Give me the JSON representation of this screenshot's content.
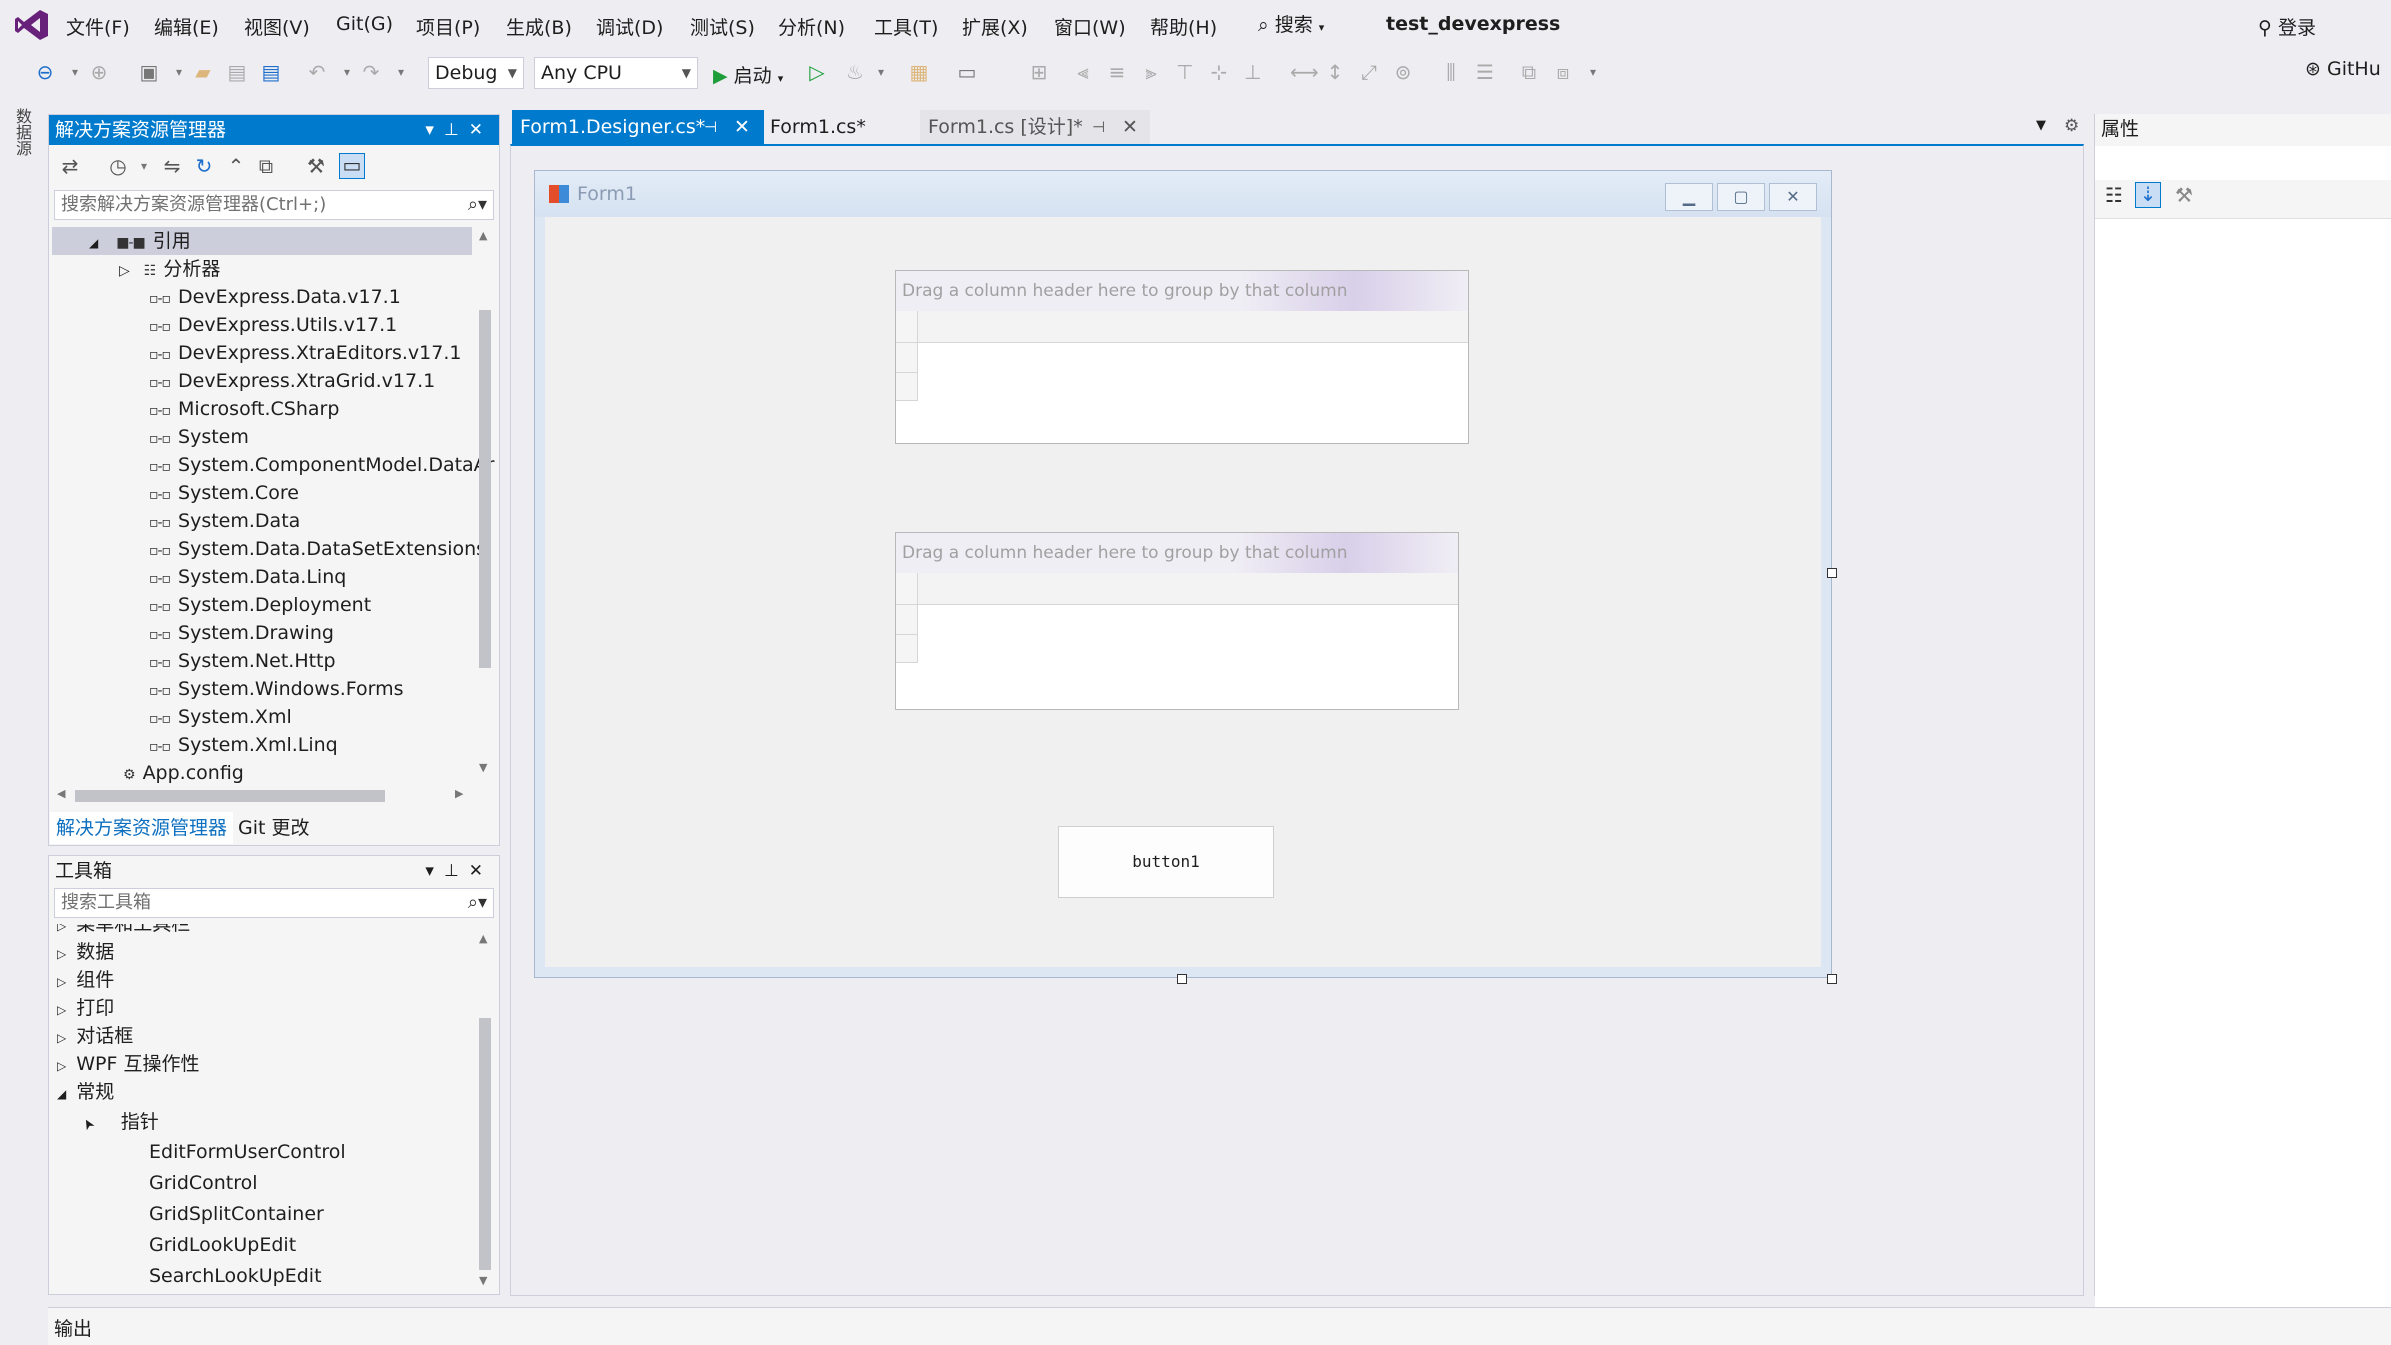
{
  "menubar": {
    "items": [
      "文件(F)",
      "编辑(E)",
      "视图(V)",
      "Git(G)",
      "项目(P)",
      "生成(B)",
      "调试(D)",
      "测试(S)",
      "分析(N)",
      "工具(T)",
      "扩展(X)",
      "窗口(W)",
      "帮助(H)"
    ],
    "search_label": "搜索",
    "solution_name": "test_devexpress",
    "login_label": "登录"
  },
  "toolbar": {
    "config_value": "Debug",
    "platform_value": "Any CPU",
    "start_label": "启动",
    "github_label": "GitHu"
  },
  "left_edge": {
    "datasource_tab": "数据源"
  },
  "solution_explorer": {
    "title": "解决方案资源管理器",
    "search_placeholder": "搜索解决方案资源管理器(Ctrl+;)",
    "tree": [
      {
        "label": "引用",
        "level": 1,
        "kind": "refs"
      },
      {
        "label": "分析器",
        "level": 2,
        "kind": "analyzer"
      },
      {
        "label": "DevExpress.Data.v17.1",
        "level": 2,
        "kind": "ref"
      },
      {
        "label": "DevExpress.Utils.v17.1",
        "level": 2,
        "kind": "ref"
      },
      {
        "label": "DevExpress.XtraEditors.v17.1",
        "level": 2,
        "kind": "ref"
      },
      {
        "label": "DevExpress.XtraGrid.v17.1",
        "level": 2,
        "kind": "ref"
      },
      {
        "label": "Microsoft.CSharp",
        "level": 2,
        "kind": "ref"
      },
      {
        "label": "System",
        "level": 2,
        "kind": "ref"
      },
      {
        "label": "System.ComponentModel.DataAr",
        "level": 2,
        "kind": "ref"
      },
      {
        "label": "System.Core",
        "level": 2,
        "kind": "ref"
      },
      {
        "label": "System.Data",
        "level": 2,
        "kind": "ref"
      },
      {
        "label": "System.Data.DataSetExtensions",
        "level": 2,
        "kind": "ref"
      },
      {
        "label": "System.Data.Linq",
        "level": 2,
        "kind": "ref"
      },
      {
        "label": "System.Deployment",
        "level": 2,
        "kind": "ref"
      },
      {
        "label": "System.Drawing",
        "level": 2,
        "kind": "ref"
      },
      {
        "label": "System.Net.Http",
        "level": 2,
        "kind": "ref"
      },
      {
        "label": "System.Windows.Forms",
        "level": 2,
        "kind": "ref"
      },
      {
        "label": "System.Xml",
        "level": 2,
        "kind": "ref"
      },
      {
        "label": "System.Xml.Linq",
        "level": 2,
        "kind": "ref"
      },
      {
        "label": "App.config",
        "level": 1,
        "kind": "file"
      }
    ],
    "bottom_tabs": [
      "解决方案资源管理器",
      "Git 更改"
    ]
  },
  "toolbox": {
    "title": "工具箱",
    "search_placeholder": "搜索工具箱",
    "categories": [
      "菜单和工具栏",
      "数据",
      "组件",
      "打印",
      "对话框",
      "WPF 互操作性",
      "常规"
    ],
    "pointer_label": "指针",
    "items": [
      "EditFormUserControl",
      "GridControl",
      "GridSplitContainer",
      "GridLookUpEdit",
      "SearchLookUpEdit"
    ]
  },
  "document_tabs": [
    {
      "label": "Form1.Designer.cs*",
      "active": true
    },
    {
      "label": "Form1.cs*",
      "active": false
    },
    {
      "label": "Form1.cs [设计]*",
      "active": false
    }
  ],
  "designer": {
    "form_title": "Form1",
    "group_panel_text": "Drag a column header here to group by that column",
    "button_text": "button1"
  },
  "properties": {
    "title": "属性"
  },
  "output": {
    "title": "输出"
  },
  "colors": {
    "accent": "#007acc",
    "background": "#eeeef2",
    "panel": "#f5f5f5",
    "border": "#cccedb"
  }
}
